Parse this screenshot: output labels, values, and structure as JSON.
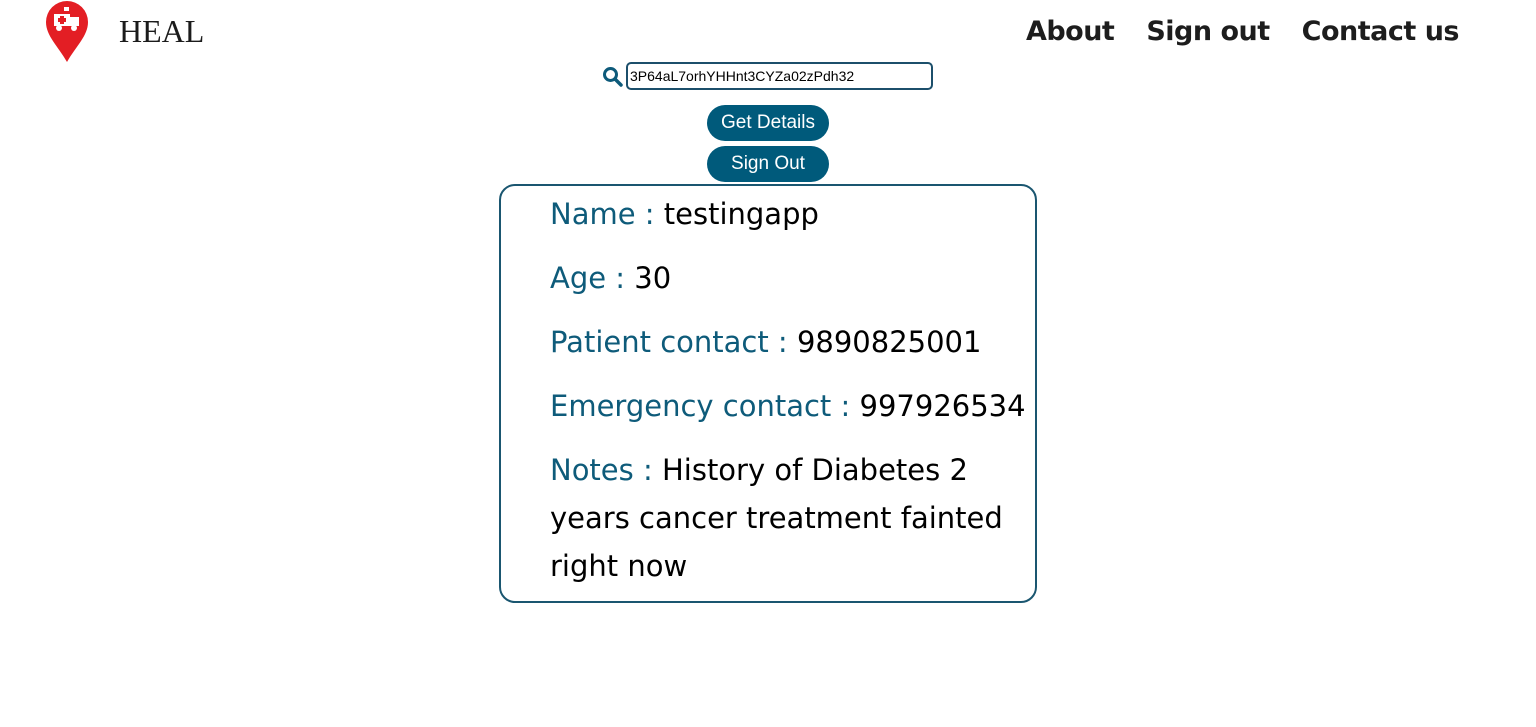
{
  "brand": {
    "name": "HEAL",
    "logo_icon": "ambulance-pin-icon",
    "logo_color": "#e31e24"
  },
  "nav": {
    "about": "About",
    "sign_out": "Sign out",
    "contact": "Contact us"
  },
  "search": {
    "icon": "search-icon",
    "value": "3P64aL7orhYHHnt3CYZa02zPdh32"
  },
  "buttons": {
    "get_details": "Get Details",
    "sign_out": "Sign Out"
  },
  "colors": {
    "accent": "#005a7b",
    "label": "#0e5b7a"
  },
  "patient": {
    "name_label": "Name : ",
    "name": "testingapp",
    "age_label": "Age : ",
    "age": "30",
    "contact_label": "Patient contact : ",
    "contact": "9890825001",
    "emergency_label": "Emergency contact : ",
    "emergency": "997926534",
    "notes_label": "Notes : ",
    "notes": "History of Diabetes 2 years cancer treatment fainted right now"
  }
}
